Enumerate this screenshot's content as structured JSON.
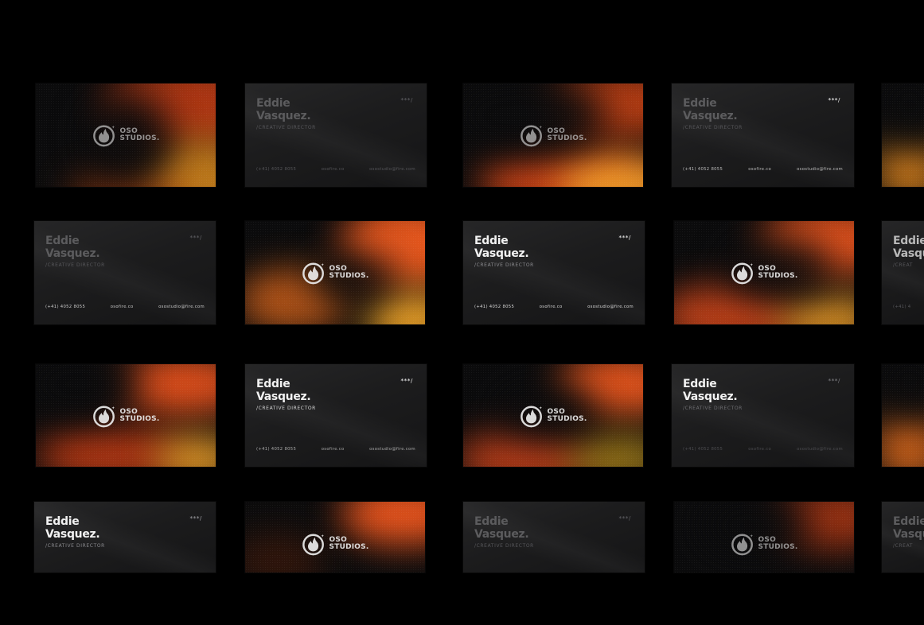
{
  "brand": {
    "logo_line1": "OSO",
    "logo_line2": "STUDIOS.",
    "logo_icon": "flame-icon",
    "accent_colors": [
      "#ff5a1f",
      "#e8461c",
      "#f5a623"
    ]
  },
  "contact": {
    "name_first": "Eddie",
    "name_last": "Vasquez.",
    "name_first_cut": "Eddie",
    "name_last_cut": "Vasqu",
    "role": "/CREATIVE DIRECTOR",
    "role_cut": "/CREAT",
    "mark": "***/",
    "phone": "(+41) 4052 8055",
    "phone_cut": "(+41) 4",
    "website": "osofire.co",
    "email": "osostudio@fire.com"
  }
}
